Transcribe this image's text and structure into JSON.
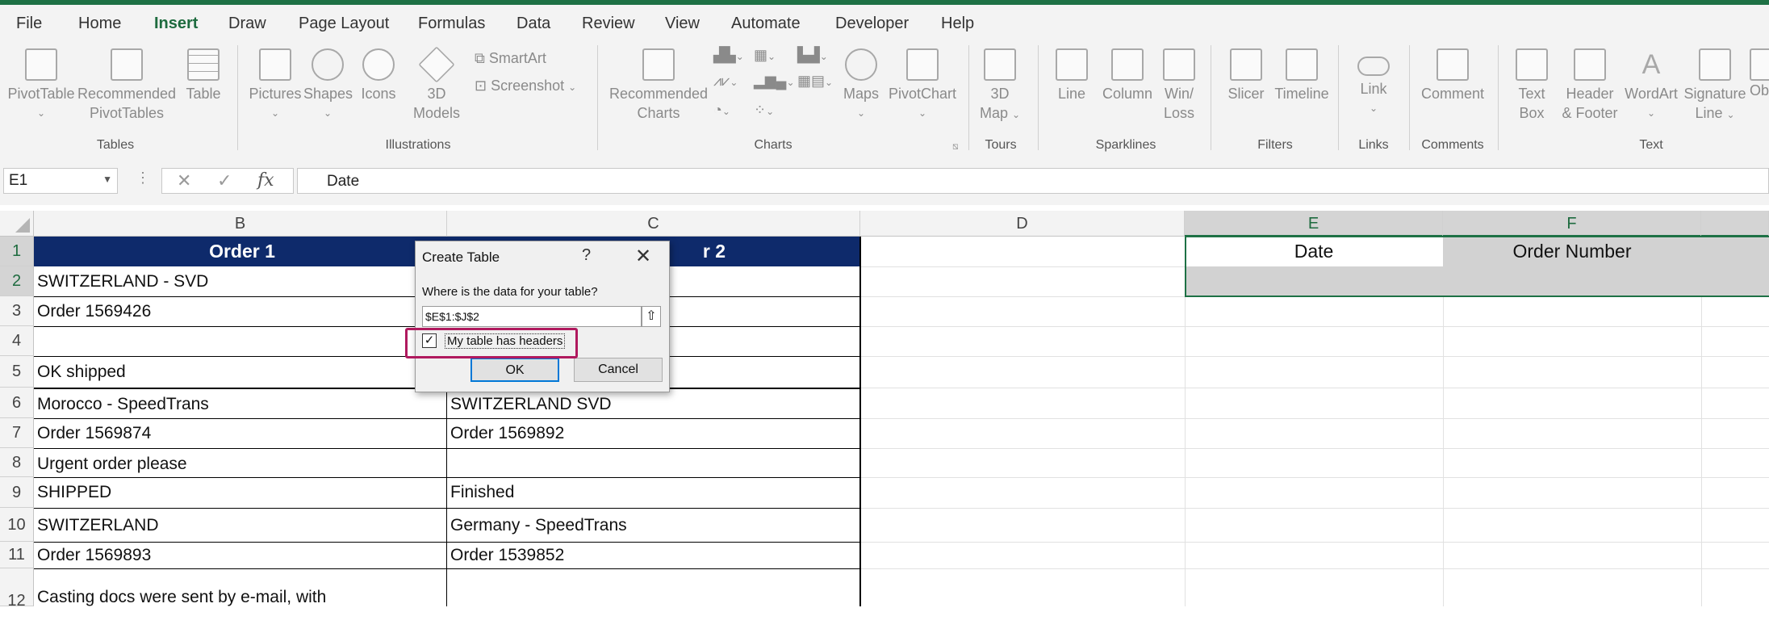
{
  "menu": {
    "tabs": [
      "File",
      "Home",
      "Insert",
      "Draw",
      "Page Layout",
      "Formulas",
      "Data",
      "Review",
      "View",
      "Automate",
      "Developer",
      "Help"
    ],
    "active": "Insert"
  },
  "ribbon": {
    "tables": {
      "group": "Tables",
      "pivottable": "PivotTable",
      "recommended": "Recommended",
      "pivottables": "PivotTables",
      "table": "Table"
    },
    "illustrations": {
      "group": "Illustrations",
      "pictures": "Pictures",
      "shapes": "Shapes",
      "icons": "Icons",
      "models1": "3D",
      "models2": "Models",
      "smartart": "SmartArt",
      "screenshot": "Screenshot"
    },
    "charts": {
      "group": "Charts",
      "recommended1": "Recommended",
      "recommended2": "Charts",
      "maps": "Maps",
      "pivotchart": "PivotChart"
    },
    "tours": {
      "group": "Tours",
      "map1": "3D",
      "map2": "Map"
    },
    "sparklines": {
      "group": "Sparklines",
      "line": "Line",
      "column": "Column",
      "winloss1": "Win/",
      "winloss2": "Loss"
    },
    "filters": {
      "group": "Filters",
      "slicer": "Slicer",
      "timeline": "Timeline"
    },
    "links": {
      "group": "Links",
      "link": "Link"
    },
    "comments": {
      "group": "Comments",
      "comment": "Comment"
    },
    "text": {
      "group": "Text",
      "textbox1": "Text",
      "textbox2": "Box",
      "header1": "Header",
      "header2": "& Footer",
      "wordart": "WordArt",
      "signature1": "Signature",
      "signature2": "Line",
      "obj": "Ob"
    }
  },
  "formula_bar": {
    "name_box": "E1",
    "fx": "fx",
    "content": "Date"
  },
  "columns": [
    "B",
    "C",
    "D",
    "E",
    "F"
  ],
  "rows": [
    "1",
    "2",
    "3",
    "4",
    "5",
    "6",
    "7",
    "8",
    "9",
    "10",
    "11",
    "12"
  ],
  "cells": {
    "b1": "Order 1",
    "c1": "r 2",
    "b2": "SWITZERLAND - SVD",
    "b3": "Order 1569426",
    "b5": "OK shipped",
    "b6": "Morocco - SpeedTrans",
    "c6": "SWITZERLAND SVD",
    "b7": "Order 1569874",
    "c7": "Order 1569892",
    "b8": "Urgent order please",
    "b9": "SHIPPED",
    "c9": "Finished",
    "b10": "SWITZERLAND",
    "c10": "Germany - SpeedTrans",
    "b11": "Order 1569893",
    "c11": "Order 1539852",
    "b12": "Casting docs were sent by e-mail, with",
    "e1": "Date",
    "f1": "Order Number"
  },
  "dialog": {
    "title": "Create Table",
    "help": "?",
    "close": "✕",
    "prompt": "Where is the data for your table?",
    "range": "$E$1:$J$2",
    "headers_label": "My table has headers",
    "headers_checked": true,
    "ok": "OK",
    "cancel": "Cancel"
  },
  "colors": {
    "header_fill": "#0e2a6b",
    "accent": "#1e7145",
    "highlight": "#b0195e"
  }
}
